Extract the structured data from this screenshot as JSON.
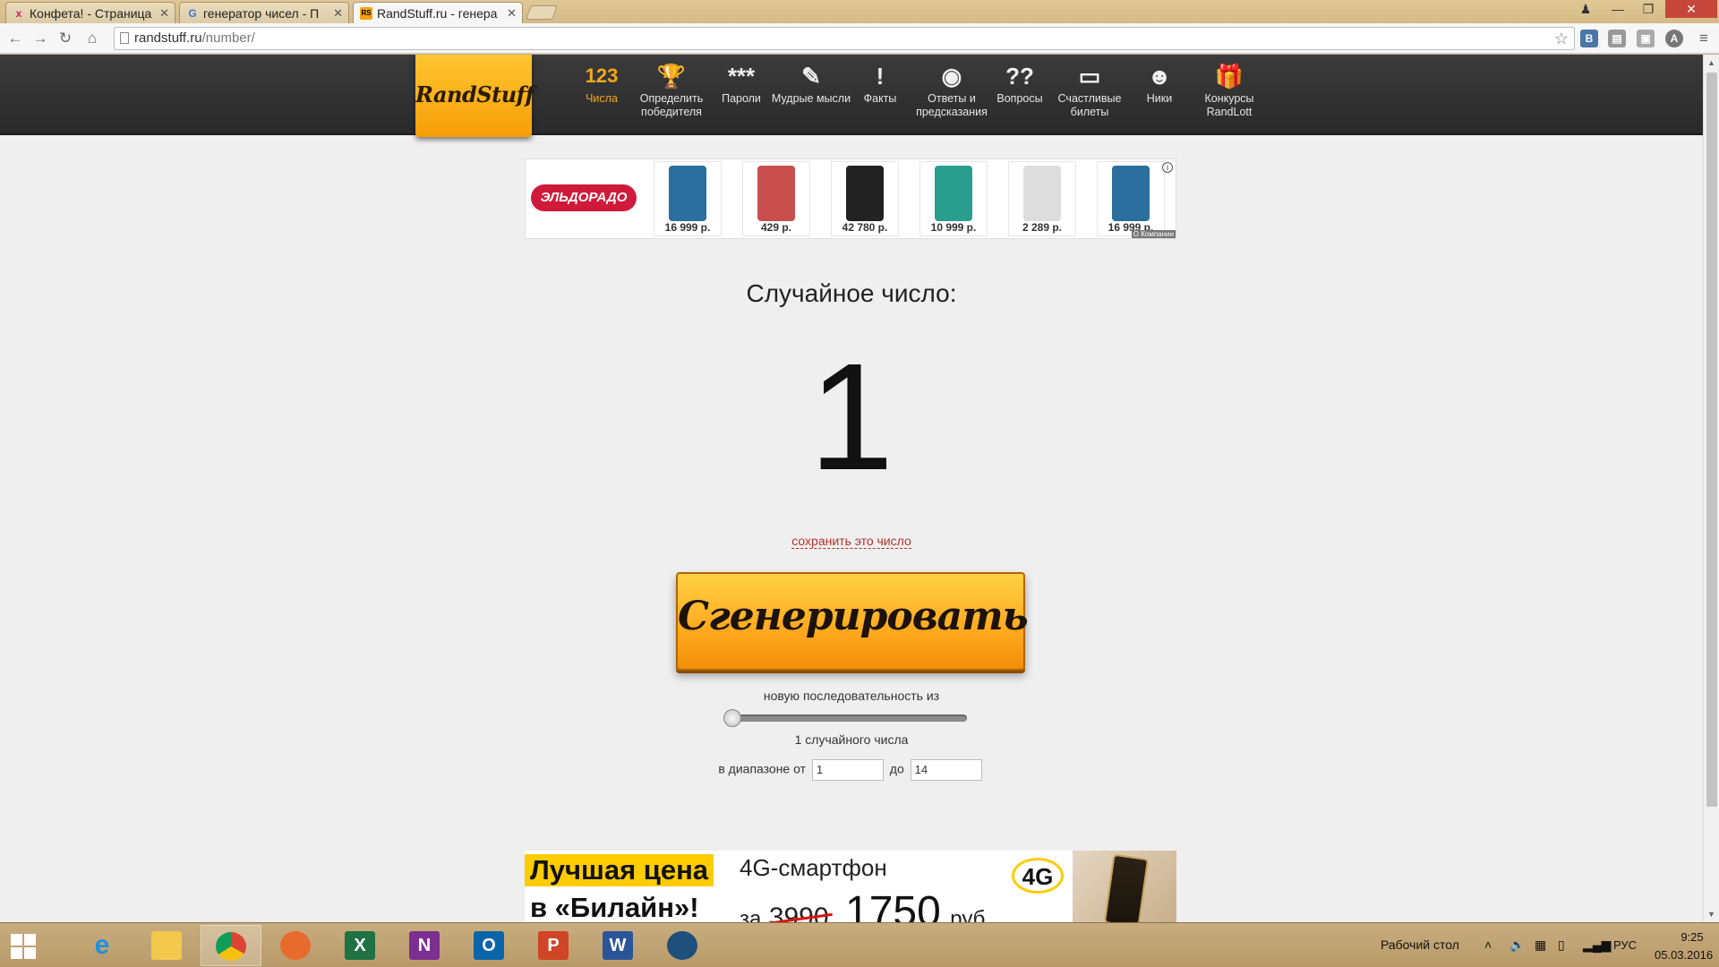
{
  "browser": {
    "tabs": [
      {
        "title": "Конфета! - Страница",
        "icon": "x"
      },
      {
        "title": "генератор чисел - П",
        "icon": "G"
      },
      {
        "title": "RandStuff.ru - генера",
        "icon": "RS"
      }
    ],
    "url_domain": "randstuff.ru",
    "url_path": "/number/"
  },
  "site": {
    "logo": "RandStuff",
    "nav": [
      {
        "icon": "123",
        "label": "Числа",
        "active": true
      },
      {
        "icon": "🏆",
        "label": "Определить победителя"
      },
      {
        "icon": "***",
        "label": "Пароли"
      },
      {
        "icon": "✎",
        "label": "Мудрые мысли"
      },
      {
        "icon": "!",
        "label": "Факты"
      },
      {
        "icon": "◉",
        "label": "Ответы и предсказания"
      },
      {
        "icon": "??",
        "label": "Вопросы"
      },
      {
        "icon": "▭",
        "label": "Счастливые билеты"
      },
      {
        "icon": "☻",
        "label": "Ники"
      },
      {
        "icon": "🎁",
        "label": "Конкурсы RandLott"
      }
    ]
  },
  "ad_top": {
    "brand": "ЭЛЬДОРАДО",
    "products": [
      {
        "price": "16 999 р.",
        "color": "#2a6f9e"
      },
      {
        "price": "429 р.",
        "color": "#c94f4f"
      },
      {
        "price": "42 780 р.",
        "color": "#222222"
      },
      {
        "price": "10 999 р.",
        "color": "#2a9e8e"
      },
      {
        "price": "2 289 р.",
        "color": "#dddddd"
      },
      {
        "price": "16 999 р.",
        "color": "#2a6f9e"
      }
    ],
    "company_label": "О Компании"
  },
  "main": {
    "result_label": "Случайное число:",
    "result_value": "1",
    "save_link": "сохранить это число",
    "generate_button": "Сгенерировать",
    "sequence_label": "новую последовательность из",
    "slider_value": 1,
    "count_label": "1 случайного числа",
    "range_prefix": "в диапазоне от",
    "range_from": "1",
    "range_to_label": "до",
    "range_to": "14"
  },
  "ad_bottom": {
    "line1": "Лучшая цена",
    "line2": "в «Билайн»!",
    "product": "4G-смартфон",
    "price_prefix": "за",
    "old_price": "3990",
    "new_price": "1750",
    "currency": "руб.",
    "badge": "4G"
  },
  "taskbar": {
    "desktop_label": "Рабочий стол",
    "lang": "РУС",
    "time": "9:25",
    "date": "05.03.2016"
  }
}
